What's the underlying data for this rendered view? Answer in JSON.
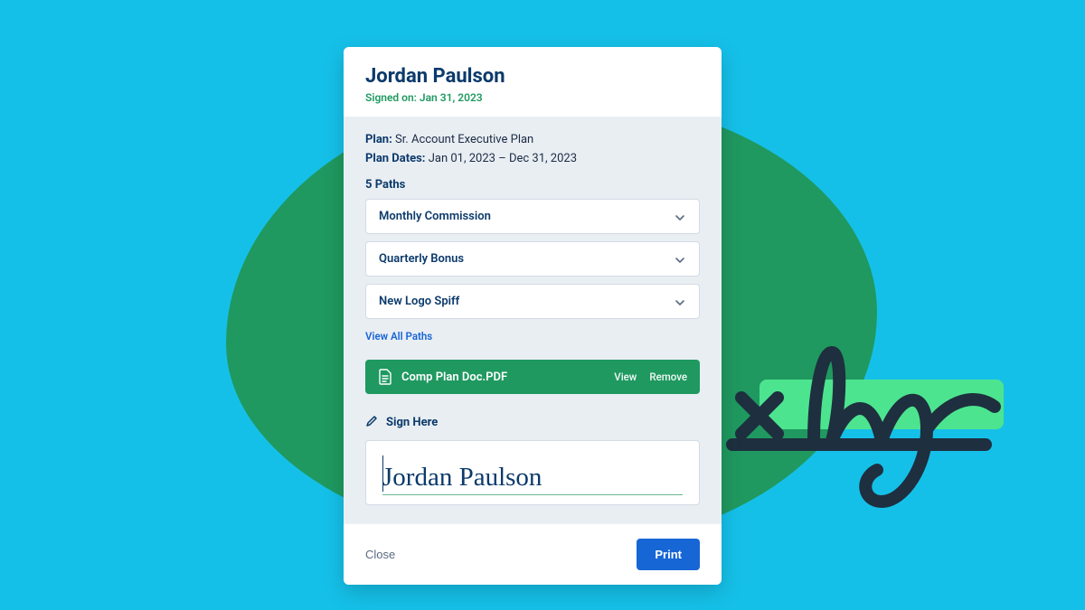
{
  "header": {
    "name": "Jordan Paulson",
    "signed_on": "Signed on: Jan 31, 2023"
  },
  "meta": {
    "plan_label": "Plan:",
    "plan_value": "Sr. Account Executive Plan",
    "dates_label": "Plan Dates:",
    "dates_value": "Jan 01, 2023 – Dec 31, 2023"
  },
  "paths": {
    "count_label": "5 Paths",
    "items": [
      {
        "label": "Monthly Commission"
      },
      {
        "label": "Quarterly Bonus"
      },
      {
        "label": "New Logo Spiff"
      }
    ],
    "view_all": "View All Paths"
  },
  "doc": {
    "name": "Comp Plan Doc.PDF",
    "view": "View",
    "remove": "Remove"
  },
  "signature": {
    "label": "Sign Here",
    "value": "Jordan Paulson"
  },
  "footer": {
    "close": "Close",
    "print": "Print"
  },
  "colors": {
    "bg": "#15c0e8",
    "blob": "#1f9960",
    "accent_green": "#4de48f",
    "navy": "#0b3a6b",
    "blue": "#1766d6"
  }
}
